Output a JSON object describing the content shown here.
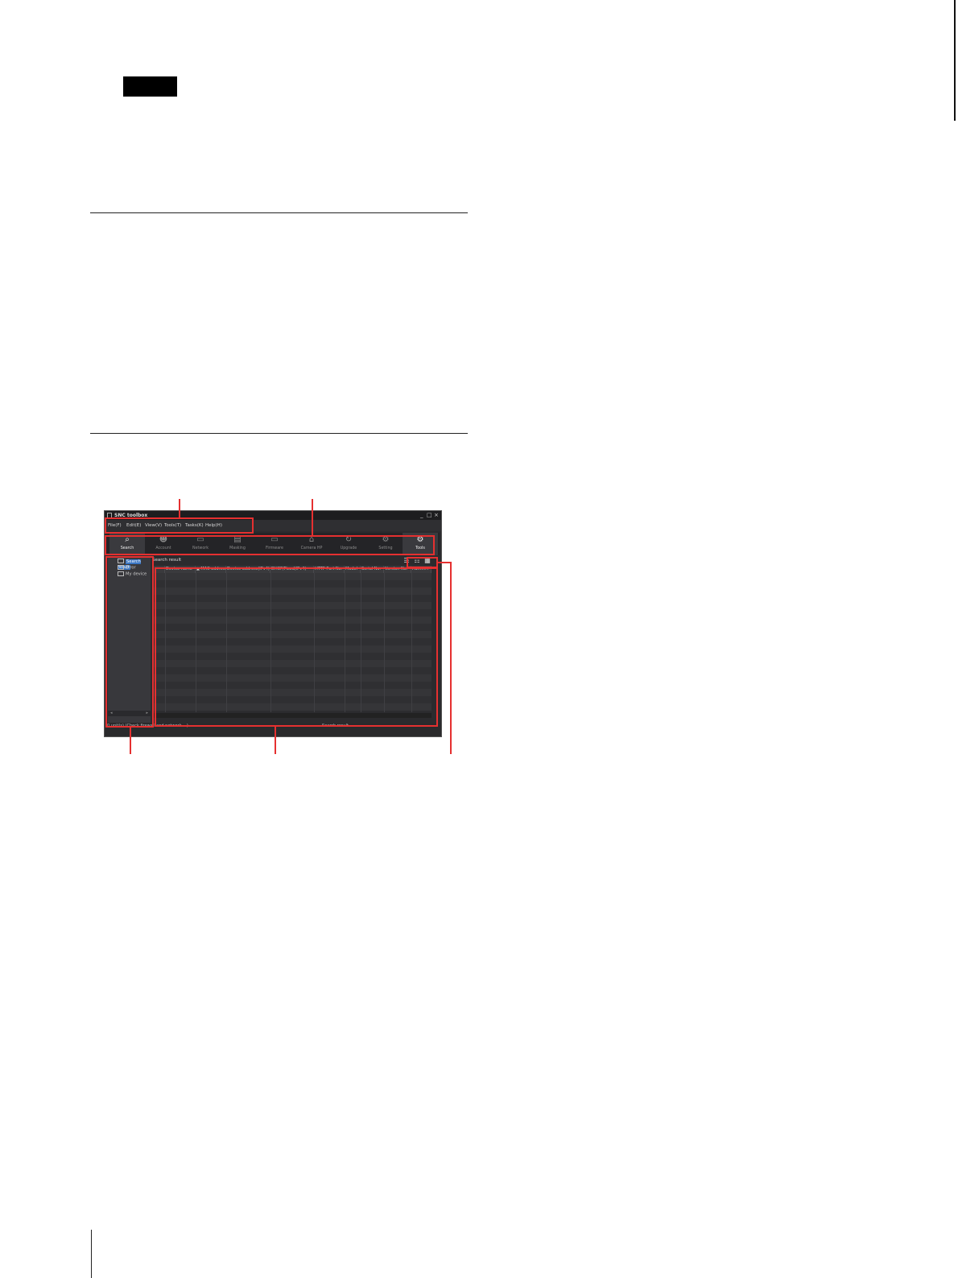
{
  "window": {
    "title": "SNC toolbox",
    "controls": {
      "minimize": "_",
      "maximize": "□",
      "close": "×"
    }
  },
  "menu": [
    "File(F)",
    "Edit(E)",
    "View(V)",
    "Tools(T)",
    "Tasks(K)",
    "Help(H)"
  ],
  "toolbar": [
    {
      "label": "Search",
      "icon": "search-icon",
      "active": true
    },
    {
      "label": "Account",
      "icon": "user-icon",
      "active": false
    },
    {
      "label": "Network",
      "icon": "network-icon",
      "active": false
    },
    {
      "label": "Masking",
      "icon": "mask-icon",
      "active": false
    },
    {
      "label": "Firmware",
      "icon": "firmware-icon",
      "active": false
    },
    {
      "label": "Camera HP",
      "icon": "camera-icon",
      "active": false
    },
    {
      "label": "Upgrade",
      "icon": "upgrade-icon",
      "active": false
    },
    {
      "label": "Setting",
      "icon": "setting-icon",
      "active": false
    },
    {
      "label": "Tools",
      "icon": "tools-icon",
      "active": true
    }
  ],
  "tree": [
    {
      "label": "Search result",
      "selected": true
    },
    {
      "label": "Error",
      "selected": false
    },
    {
      "label": "My device",
      "selected": false
    }
  ],
  "results": {
    "label": "Search result",
    "columns": [
      "",
      "Device name",
      "▲ MAC address",
      "Device address(IPv4)",
      "DHCP/Fixed(IPv4)",
      "HTTP Port No.",
      "Model",
      "Serial No.",
      "Version No.",
      "Admin..."
    ]
  },
  "status": {
    "left": "0 unit(s) (Check firewall and network ...)",
    "right": "Search result"
  },
  "colors": {
    "callout": "#e53030",
    "selection": "#3a76c4"
  }
}
